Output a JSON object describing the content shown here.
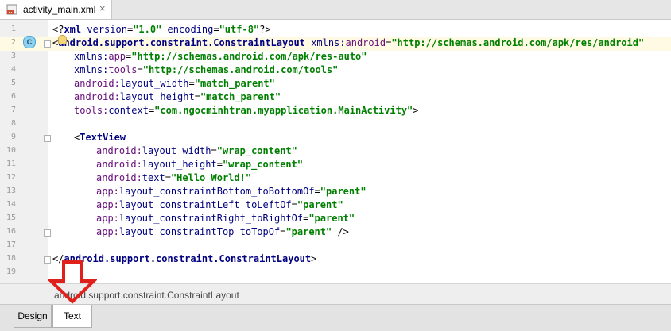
{
  "editor_tab": {
    "file_name": "activity_main.xml",
    "close_glyph": "×",
    "icon": "xml-file-icon"
  },
  "gutter": {
    "line_numbers": [
      "1",
      "2",
      "3",
      "4",
      "5",
      "6",
      "7",
      "8",
      "9",
      "10",
      "11",
      "12",
      "13",
      "14",
      "15",
      "16",
      "17",
      "18",
      "19"
    ],
    "class_badge": "C",
    "current_line": "3"
  },
  "code": {
    "l1": {
      "open": "<?",
      "tag": "xml",
      "attr1": "version",
      "val1": "\"1.0\"",
      "attr2": "encoding",
      "val2": "\"utf-8\"",
      "close": "?>"
    },
    "l2": {
      "lt": "<",
      "tag": "android.support.constraint.ConstraintLayout",
      "ns_prefix": "xmlns:",
      "ns_name": "android",
      "eq": "=",
      "val": "\"http://schemas.android.com/apk/res/android\""
    },
    "l3": {
      "ns_prefix": "xmlns:",
      "ns_name": "app",
      "eq": "=",
      "val": "\"http://schemas.android.com/apk/res-auto\""
    },
    "l4": {
      "ns_prefix": "xmlns:",
      "ns_name": "tools",
      "eq": "=",
      "val": "\"http://schemas.android.com/tools\""
    },
    "l5": {
      "prefix": "android:",
      "name": "layout_width",
      "eq": "=",
      "val": "\"match_parent\""
    },
    "l6": {
      "prefix": "android:",
      "name": "layout_height",
      "eq": "=",
      "val": "\"match_parent\""
    },
    "l7": {
      "prefix": "tools:",
      "name": "context",
      "eq": "=",
      "val": "\"com.ngocminhtran.myapplication.MainActivity\"",
      "close": ">"
    },
    "l9": {
      "lt": "<",
      "tag": "TextView"
    },
    "l10": {
      "prefix": "android:",
      "name": "layout_width",
      "eq": "=",
      "val": "\"wrap_content\""
    },
    "l11": {
      "prefix": "android:",
      "name": "layout_height",
      "eq": "=",
      "val": "\"wrap_content\""
    },
    "l12": {
      "prefix": "android:",
      "name": "text",
      "eq": "=",
      "val": "\"Hello World!\""
    },
    "l13": {
      "prefix": "app:",
      "name": "layout_constraintBottom_toBottomOf",
      "eq": "=",
      "val": "\"parent\""
    },
    "l14": {
      "prefix": "app:",
      "name": "layout_constraintLeft_toLeftOf",
      "eq": "=",
      "val": "\"parent\""
    },
    "l15": {
      "prefix": "app:",
      "name": "layout_constraintRight_toRightOf",
      "eq": "=",
      "val": "\"parent\""
    },
    "l16": {
      "prefix": "app:",
      "name": "layout_constraintTop_toTopOf",
      "eq": "=",
      "val": "\"parent\"",
      "close": " />"
    },
    "l18": {
      "lt": "</",
      "tag": "android.support.constraint.ConstraintLayout",
      "close": ">"
    }
  },
  "breadcrumb": "android.support.constraint.ConstraintLayout",
  "bottom_tabs": {
    "design": "Design",
    "text": "Text",
    "selected": "Text"
  },
  "annotation": {
    "icon": "red-down-arrow-icon",
    "color": "#e0201a"
  },
  "colors": {
    "tag": "#000080",
    "value": "#008000",
    "current_line": "#fffae3",
    "gutter": "#f0f0f0"
  }
}
